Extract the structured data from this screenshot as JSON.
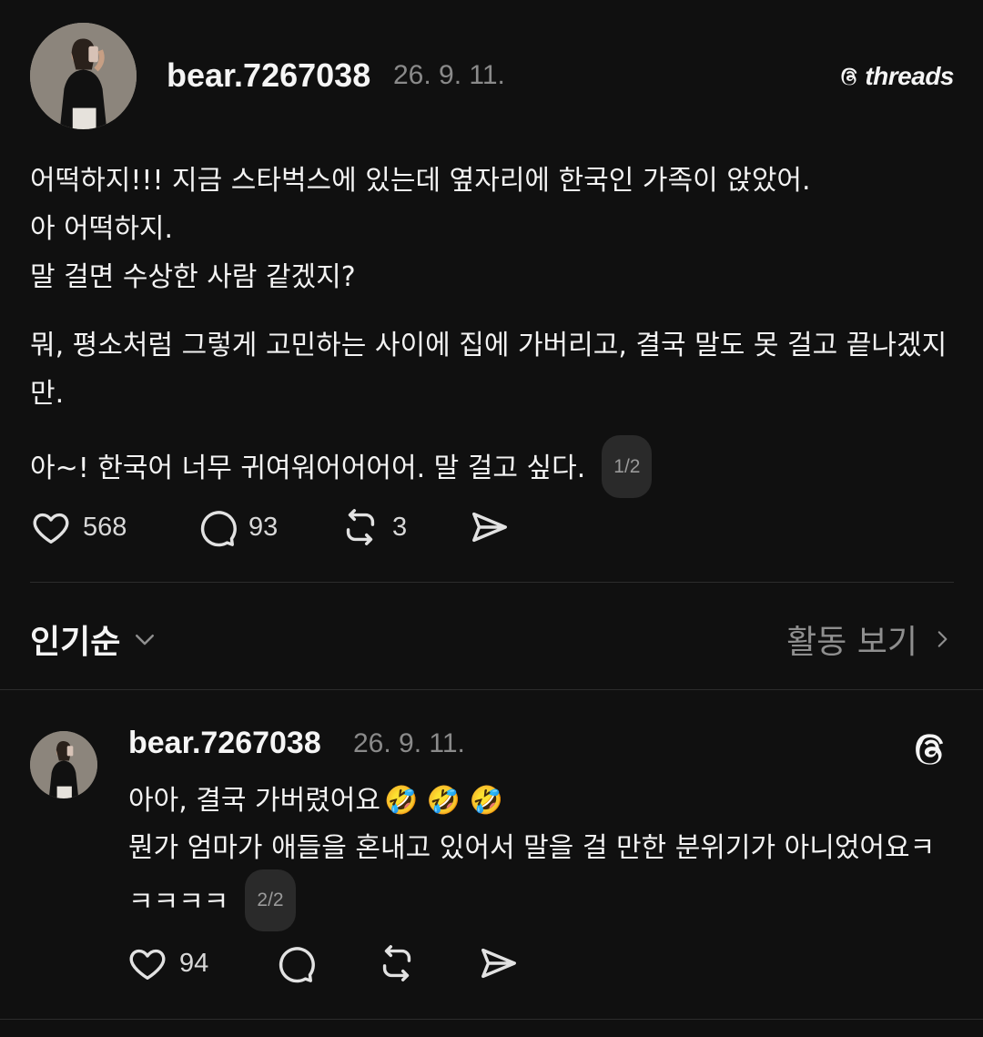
{
  "brand": {
    "name": "threads",
    "icon": "threads-logo-icon"
  },
  "post": {
    "username": "bear.7267038",
    "date": "26. 9. 11.",
    "paragraphs": [
      "어떡하지!!! 지금 스타벅스에 있는데 옆자리에 한국인 가족이 앉았어.",
      "아 어떡하지.",
      "말 걸면 수상한 사람 같겠지?",
      "뭐, 평소처럼 그렇게 고민하는 사이에 집에 가버리고, 결국 말도 못 걸고 끝나겠지만.",
      "아~! 한국어 너무 귀여워어어어어. 말 걸고 싶다."
    ],
    "pager": "1/2",
    "likes": "568",
    "comments": "93",
    "reposts": "3"
  },
  "sort": {
    "label": "인기순",
    "activity_link": "활동 보기"
  },
  "reply": {
    "username": "bear.7267038",
    "date": "26. 9. 11.",
    "line1": "아아, 결국 가버렸어요",
    "emojis": "🤣 🤣 🤣",
    "line2": "뭔가 엄마가 애들을 혼내고 있어서 말을 걸 만한 분위기가 아니었어요ㅋㅋㅋㅋㅋ",
    "pager": "2/2",
    "likes": "94"
  },
  "colors": {
    "background": "#101010",
    "text": "#f3f3f3",
    "muted": "#8a8a8a",
    "pager_bg": "#2a2a2a"
  }
}
